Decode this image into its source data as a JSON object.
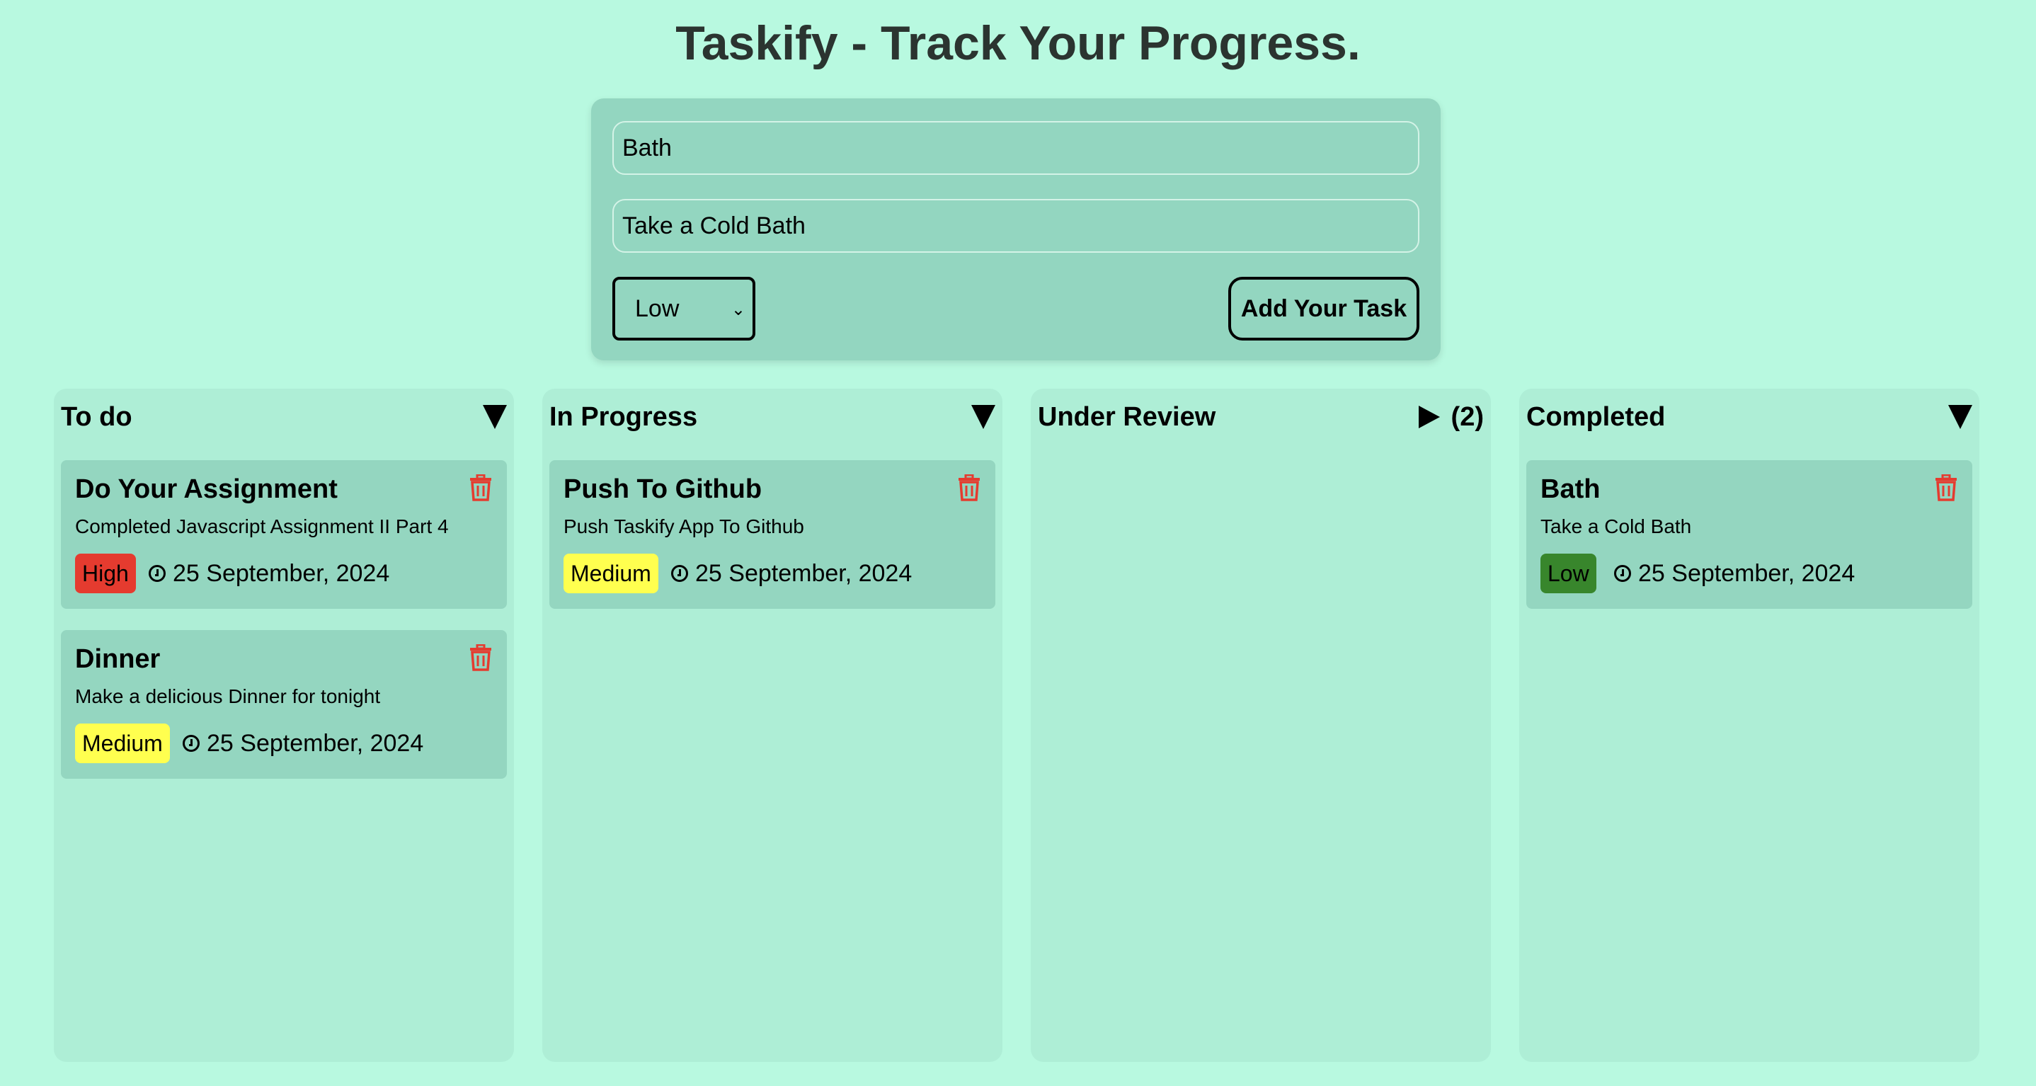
{
  "header": {
    "title": "Taskify - Track Your Progress."
  },
  "form": {
    "title_value": "Bath",
    "description_value": "Take a Cold Bath",
    "priority_selected": "Low",
    "add_button_label": "Add Your Task"
  },
  "columns": [
    {
      "title": "To do",
      "collapsed": false,
      "cards": [
        {
          "title": "Do Your Assignment",
          "description": "Completed Javascript Assignment II Part 4",
          "priority": "High",
          "date": "25 September, 2024"
        },
        {
          "title": "Dinner",
          "description": "Make a delicious Dinner for tonight",
          "priority": "Medium",
          "date": "25 September, 2024"
        }
      ]
    },
    {
      "title": "In Progress",
      "collapsed": false,
      "cards": [
        {
          "title": "Push To Github",
          "description": "Push Taskify App To Github",
          "priority": "Medium",
          "date": "25 September, 2024"
        }
      ]
    },
    {
      "title": "Under Review",
      "collapsed": true,
      "count": "(2)",
      "cards": []
    },
    {
      "title": "Completed",
      "collapsed": false,
      "cards": [
        {
          "title": "Bath",
          "description": "Take a Cold Bath",
          "priority": "Low",
          "date": "25 September, 2024"
        }
      ]
    }
  ],
  "icons": {
    "delete": "trash-icon",
    "date": "clock-icon",
    "expand": "triangle-down-icon",
    "collapsed": "triangle-right-icon"
  },
  "colors": {
    "background": "#b8f9e0",
    "form_bg": "#93d6c0",
    "column_bg": "#aeeed6",
    "card_bg": "#94d6c0",
    "priority_high": "#e53b2f",
    "priority_medium": "#ffff4f",
    "priority_low": "#38862c",
    "trash": "#e53b2f"
  }
}
